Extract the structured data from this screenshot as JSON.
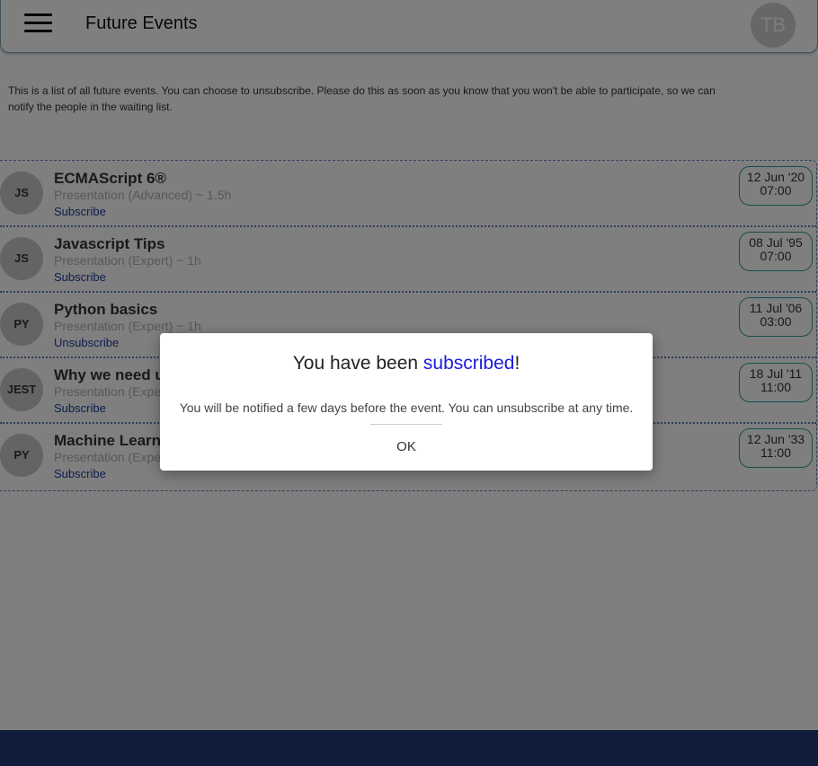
{
  "header": {
    "title": "Future Events",
    "user_initials": "TB",
    "menu_icon": "hamburger-menu-icon"
  },
  "intro_text": "This is a list of all future events. You can choose to unsubscribe. Please do this as soon as you know that you won't be able to participate, so we can notify the people in the waiting list.",
  "events": [
    {
      "avatar": "JS",
      "title": "ECMAScript 6®",
      "subtitle": "Presentation (Advanced) ~ 1.5h",
      "action": "Subscribe",
      "date": "12 Jun '20",
      "time": "07:00"
    },
    {
      "avatar": "JS",
      "title": "Javascript Tips",
      "subtitle": "Presentation (Expert) ~ 1h",
      "action": "Subscribe",
      "date": "08 Jul '95",
      "time": "07:00"
    },
    {
      "avatar": "PY",
      "title": "Python basics",
      "subtitle": "Presentation (Expert) ~ 1h",
      "action": "Unsubscribe",
      "date": "11 Jul '06",
      "time": "03:00"
    },
    {
      "avatar": "JEST",
      "title": "Why we need u",
      "subtitle": "Presentation (Expe",
      "action": "Subscribe",
      "date": "18 Jul '11",
      "time": "11:00"
    },
    {
      "avatar": "PY",
      "title": "Machine Learni",
      "subtitle": "Presentation (Expe",
      "action": "Subscribe",
      "date": "12 Jun '33",
      "time": "11:00"
    }
  ],
  "modal": {
    "title_prefix": "You have been ",
    "title_highlight": "subscribed",
    "title_suffix": "!",
    "message": "You will be notified a few days before the event. You can unsubscribe at any time.",
    "ok_label": "OK"
  },
  "colors": {
    "accent_link": "#1a3d9e",
    "date_border": "#2a9d9c",
    "footer": "#243878",
    "highlight": "#1a1adf"
  }
}
